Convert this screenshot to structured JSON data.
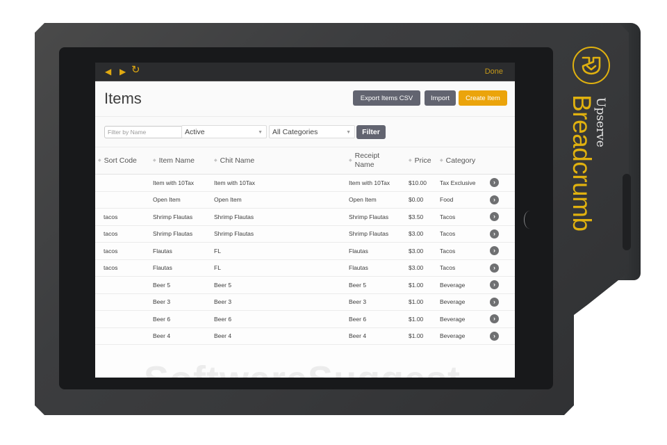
{
  "device": {
    "brand_top": "Upserve",
    "brand_main": "Breadcrumb",
    "logo_icon": "breadcrumb-logo-icon",
    "accent_color": "#e0b10f"
  },
  "topbar": {
    "back_icon": "◀",
    "forward_icon": "▶",
    "refresh_icon": "↻",
    "done_label": "Done"
  },
  "header": {
    "title": "Items",
    "export_label": "Export Items CSV",
    "import_label": "Import",
    "create_label": "Create Item",
    "create_color": "#eba40b",
    "secondary_color": "#626470"
  },
  "filters": {
    "name_placeholder": "Filter by Name",
    "name_value": "",
    "status_selected": "Active",
    "category_selected": "All Categories",
    "filter_label": "Filter"
  },
  "table": {
    "columns": [
      "Sort Code",
      "Item Name",
      "Chit Name",
      "Receipt Name",
      "Price",
      "Category"
    ],
    "receipt_line1": "Receipt",
    "receipt_line2": "Name",
    "rows": [
      {
        "sort_code": "",
        "item_name": "Item with 10Tax",
        "chit_name": "Item with 10Tax",
        "receipt_name": "Item with 10Tax",
        "price": "$10.00",
        "category": "Tax Exclusive"
      },
      {
        "sort_code": "",
        "item_name": "Open Item",
        "chit_name": "Open Item",
        "receipt_name": "Open Item",
        "price": "$0.00",
        "category": "Food"
      },
      {
        "sort_code": "tacos",
        "item_name": "Shrimp Flautas",
        "chit_name": "Shrimp Flautas",
        "receipt_name": "Shrimp Flautas",
        "price": "$3.50",
        "category": "Tacos"
      },
      {
        "sort_code": "tacos",
        "item_name": "Shrimp Flautas",
        "chit_name": "Shrimp Flautas",
        "receipt_name": "Shrimp Flautas",
        "price": "$3.00",
        "category": "Tacos"
      },
      {
        "sort_code": "tacos",
        "item_name": "Flautas",
        "chit_name": "FL",
        "receipt_name": "Flautas",
        "price": "$3.00",
        "category": "Tacos"
      },
      {
        "sort_code": "tacos",
        "item_name": "Flautas",
        "chit_name": "FL",
        "receipt_name": "Flautas",
        "price": "$3.00",
        "category": "Tacos"
      },
      {
        "sort_code": "",
        "item_name": "Beer 5",
        "chit_name": "Beer 5",
        "receipt_name": "Beer 5",
        "price": "$1.00",
        "category": "Beverage"
      },
      {
        "sort_code": "",
        "item_name": "Beer 3",
        "chit_name": "Beer 3",
        "receipt_name": "Beer 3",
        "price": "$1.00",
        "category": "Beverage"
      },
      {
        "sort_code": "",
        "item_name": "Beer 6",
        "chit_name": "Beer 6",
        "receipt_name": "Beer 6",
        "price": "$1.00",
        "category": "Beverage"
      },
      {
        "sort_code": "",
        "item_name": "Beer 4",
        "chit_name": "Beer 4",
        "receipt_name": "Beer 4",
        "price": "$1.00",
        "category": "Beverage"
      }
    ],
    "row_action_icon": "›"
  },
  "watermark": "SoftwareSuggest"
}
